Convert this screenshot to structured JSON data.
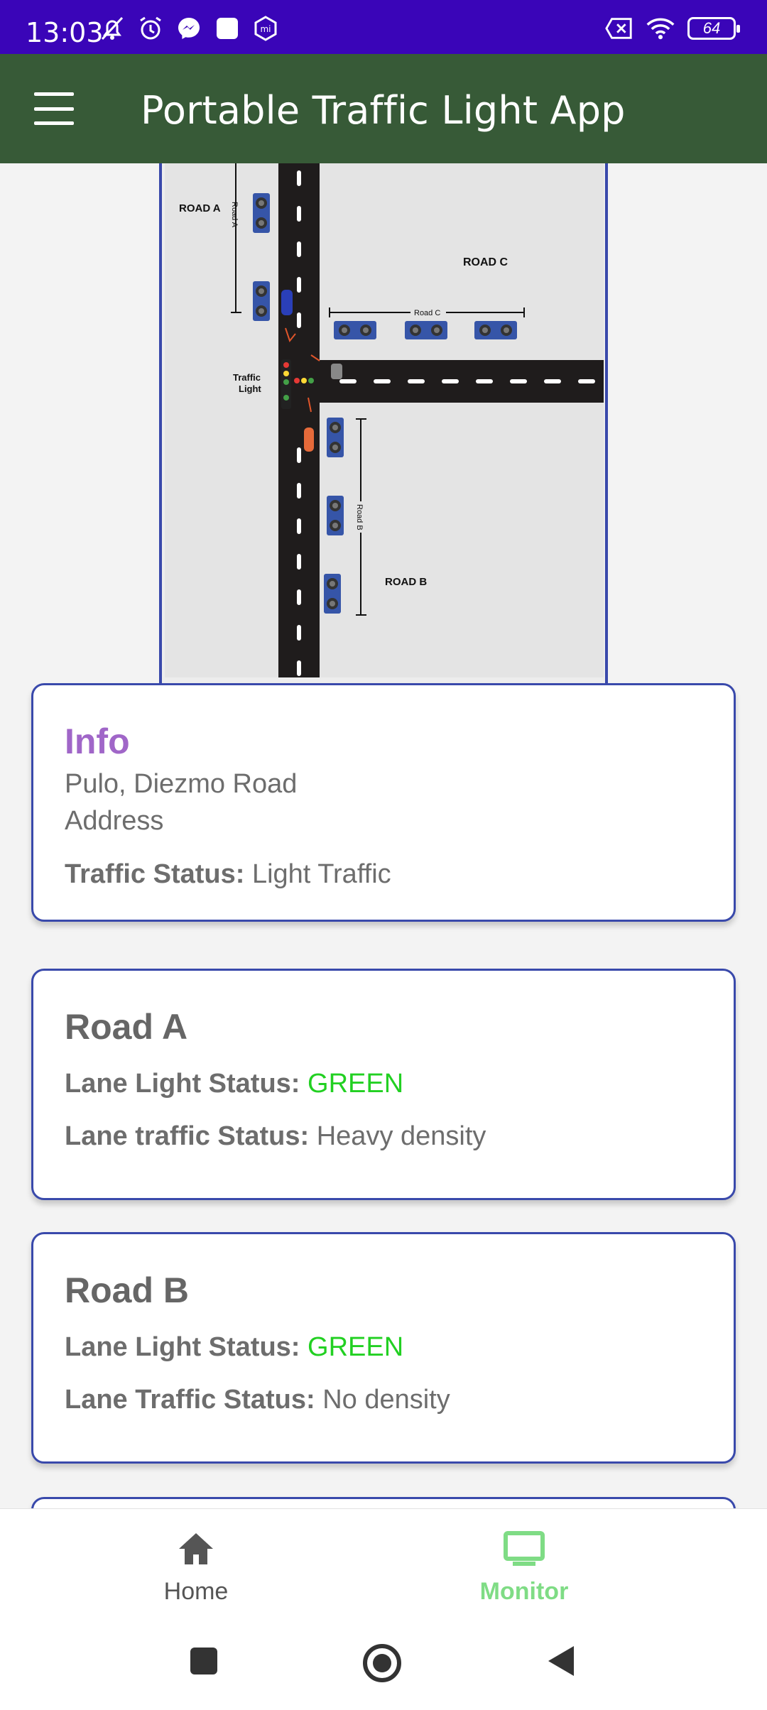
{
  "status_bar": {
    "time": "13:03",
    "battery": "64"
  },
  "app_bar": {
    "title": "Portable Traffic Light App"
  },
  "diagram": {
    "road_a": "ROAD A",
    "road_a_small": "Road A",
    "road_b": "ROAD B",
    "road_b_small": "Road B",
    "road_c": "ROAD C",
    "road_c_small": "Road C",
    "traffic_light_1": "Traffic",
    "traffic_light_2": "Light"
  },
  "info": {
    "title": "Info",
    "location": "Pulo, Diezmo Road",
    "address_label": "Address",
    "traffic_status_label": "Traffic Status:",
    "traffic_status_value": "Light Traffic"
  },
  "roads": [
    {
      "title": "Road A",
      "light_label": "Lane Light Status:",
      "light_value": "GREEN",
      "traffic_label": "Lane traffic Status:",
      "traffic_value": "Heavy density"
    },
    {
      "title": "Road B",
      "light_label": "Lane Light Status:",
      "light_value": "GREEN",
      "traffic_label": "Lane Traffic Status:",
      "traffic_value": "No density"
    }
  ],
  "bottom_nav": {
    "home_label": "Home",
    "monitor_label": "Monitor",
    "active": "Monitor"
  },
  "colors": {
    "status_bar": "#3a05b8",
    "app_bar": "#375a37",
    "card_border": "#3949ab",
    "info_title": "#a066c8",
    "green_status": "#22d022",
    "nav_active": "#7fdc85"
  }
}
